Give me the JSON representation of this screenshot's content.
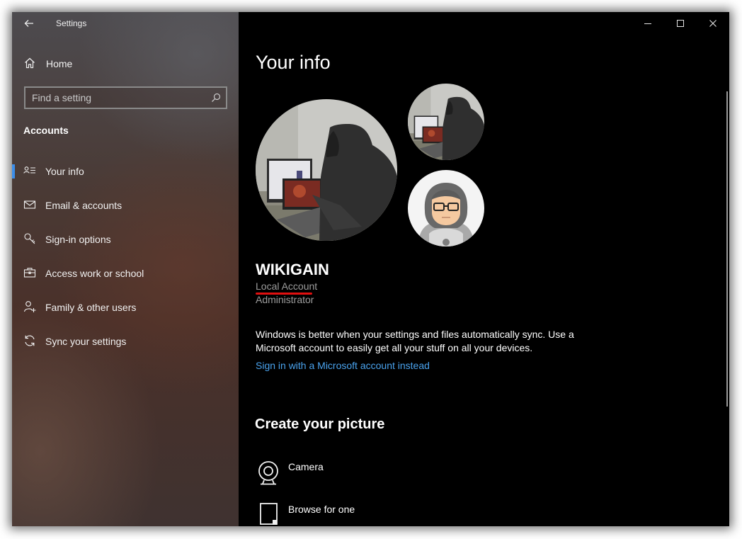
{
  "window": {
    "app_title": "Settings",
    "controls": {
      "minimize": "minimize-icon",
      "maximize": "maximize-icon",
      "close": "close-icon"
    },
    "back_icon": "back-arrow-icon"
  },
  "sidebar": {
    "home": {
      "label": "Home",
      "icon": "home-icon"
    },
    "search": {
      "placeholder": "Find a setting",
      "value": "",
      "icon": "search-icon"
    },
    "section_heading": "Accounts",
    "items": [
      {
        "label": "Your info",
        "icon": "user-card-icon",
        "active": true
      },
      {
        "label": "Email & accounts",
        "icon": "mail-icon",
        "active": false
      },
      {
        "label": "Sign-in options",
        "icon": "key-icon",
        "active": false
      },
      {
        "label": "Access work or school",
        "icon": "briefcase-icon",
        "active": false
      },
      {
        "label": "Family & other users",
        "icon": "person-add-icon",
        "active": false
      },
      {
        "label": "Sync your settings",
        "icon": "sync-icon",
        "active": false
      }
    ],
    "accent_color": "#3b8eea"
  },
  "main": {
    "page_title": "Your info",
    "account": {
      "name": "WIKIGAIN",
      "type": "Local Account",
      "role": "Administrator"
    },
    "sync_message": "Windows is better when your settings and files automatically sync. Use a Microsoft account to easily get all your stuff on all your devices.",
    "ms_link": "Sign in with a Microsoft account instead",
    "link_color": "#4aa3ee",
    "annotation_color": "#e01010",
    "create_picture": {
      "heading": "Create your picture",
      "options": [
        {
          "label": "Camera",
          "icon": "camera-icon"
        },
        {
          "label": "Browse for one",
          "icon": "browse-file-icon"
        }
      ]
    }
  }
}
